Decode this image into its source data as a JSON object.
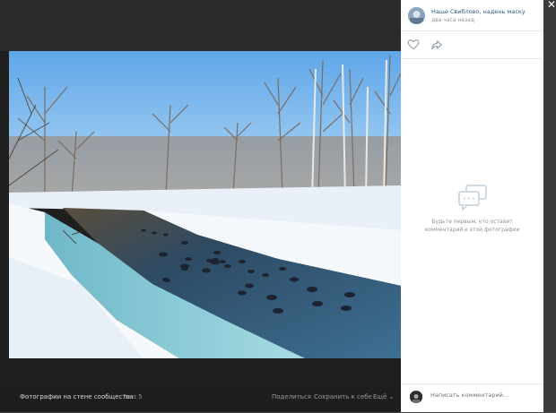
{
  "album": {
    "title": "Фотографии на стене сообщества",
    "counter": "5 из 5"
  },
  "bottom_actions": {
    "share": "Поделиться",
    "save": "Сохранить к себе",
    "more": "Ещё ⌄"
  },
  "post": {
    "author": "Наше Свиблово, надень маску",
    "time": "два часа назад"
  },
  "comments": {
    "empty_text": "Будьте первым, кто оставит комментарий к этой фотографии",
    "input_placeholder": "Написать комментарий..."
  },
  "icons": {
    "like": "heart-icon",
    "share": "share-arrow-icon",
    "close": "close-icon",
    "empty": "comments-icon"
  },
  "colors": {
    "link": "#2a5885",
    "muted": "#939393",
    "sky": "#8ec4ef",
    "snow": "#f2f6fb",
    "water": "#3a5f7a"
  }
}
